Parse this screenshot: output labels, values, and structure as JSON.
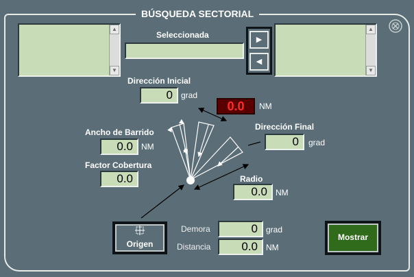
{
  "title": "BÚSQUEDA SECTORIAL",
  "close_icon": "circled-x-icon",
  "seleccionada": {
    "label": "Seleccionada",
    "value": ""
  },
  "left_list": {
    "items": []
  },
  "right_list": {
    "items": []
  },
  "arrows": {
    "right": "▶",
    "left": "◀"
  },
  "direccion_inicial": {
    "label": "Dirección Inicial",
    "value": "0",
    "unit": "grad"
  },
  "red_display": {
    "value": "0.0",
    "unit": "NM",
    "color": "#ff2a2a"
  },
  "direccion_final": {
    "label": "Dirección Final",
    "value": "0",
    "unit": "grad"
  },
  "ancho_barrido": {
    "label": "Ancho de Barrido",
    "value": "0.0",
    "unit": "NM"
  },
  "factor_cobertura": {
    "label": "Factor Cobertura",
    "value": "0.0"
  },
  "radio": {
    "label": "Radio",
    "value": "0.0",
    "unit": "NM"
  },
  "origen_button": {
    "label": "Origen",
    "icon": "crosshair-icon"
  },
  "demora": {
    "label": "Demora",
    "value": "0",
    "unit": "grad"
  },
  "distancia": {
    "label": "Distancia",
    "value": "0.0",
    "unit": "NM"
  },
  "mostrar_button": {
    "label": "Mostrar",
    "color": "#2f6b1a"
  },
  "colors": {
    "panel": "#5b6e77",
    "field": "#c8dcb8",
    "frame": "#e8ece8"
  }
}
